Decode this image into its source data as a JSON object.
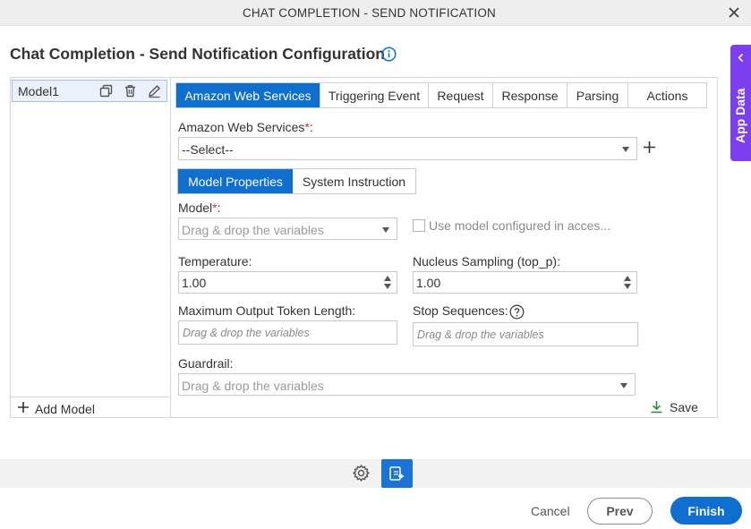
{
  "window": {
    "title": "CHAT COMPLETION - SEND NOTIFICATION"
  },
  "page": {
    "heading": "Chat Completion - Send Notification Configuration"
  },
  "models": {
    "items": [
      {
        "label": "Model1"
      }
    ],
    "add_label": "Add Model"
  },
  "tabs": [
    {
      "label": "Amazon Web Services",
      "active": true
    },
    {
      "label": "Triggering Event"
    },
    {
      "label": "Request"
    },
    {
      "label": "Response"
    },
    {
      "label": "Parsing"
    },
    {
      "label": "Actions"
    }
  ],
  "aws": {
    "label": "Amazon Web Services",
    "value": "--Select--"
  },
  "inner_tabs": [
    {
      "label": "Model Properties",
      "active": true
    },
    {
      "label": "System Instruction"
    }
  ],
  "fields": {
    "model": {
      "label": "Model",
      "placeholder": "Drag & drop the variables"
    },
    "use_model": {
      "label": "Use model configured in acces..."
    },
    "temperature": {
      "label": "Temperature:",
      "value": "1.00"
    },
    "top_p": {
      "label": "Nucleus Sampling (top_p):",
      "value": "1.00"
    },
    "max_tokens": {
      "label": "Maximum Output Token Length:",
      "placeholder": "Drag & drop the variables"
    },
    "stop_sequences": {
      "label": "Stop Sequences:",
      "placeholder": "Drag & drop the variables"
    },
    "guardrail": {
      "label": "Guardrail:",
      "placeholder": "Drag & drop the variables"
    }
  },
  "save_label": "Save",
  "side_panel": {
    "label": "App Data"
  },
  "footer": {
    "cancel": "Cancel",
    "prev": "Prev",
    "finish": "Finish"
  },
  "colors": {
    "primary": "#0f6fd1",
    "side_tab": "#7b3ff0",
    "required": "#d32f2f"
  }
}
